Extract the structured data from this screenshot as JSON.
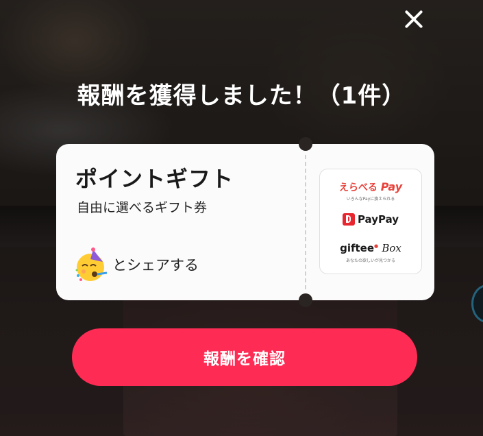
{
  "modal": {
    "title": "報酬を獲得しました！（1件）",
    "close_icon": "close-icon"
  },
  "reward_card": {
    "title": "ポイントギフト",
    "subtitle": "自由に選べるギフト券",
    "share_emoji": "🥳",
    "share_label": "とシェアする",
    "brands": {
      "erabel_main": "えらべる",
      "erabel_pay": "Pay",
      "erabel_sub": "いろんなPayに換えられる",
      "paypay": "PayPay",
      "giftee_main": "giftee",
      "giftee_box": "Box",
      "giftee_sub": "あなたの欲しいが見つかる"
    }
  },
  "actions": {
    "confirm_label": "報酬を確認"
  },
  "colors": {
    "accent": "#fe2c55",
    "erabel": "#e8423a",
    "paypay": "#e8262f"
  }
}
